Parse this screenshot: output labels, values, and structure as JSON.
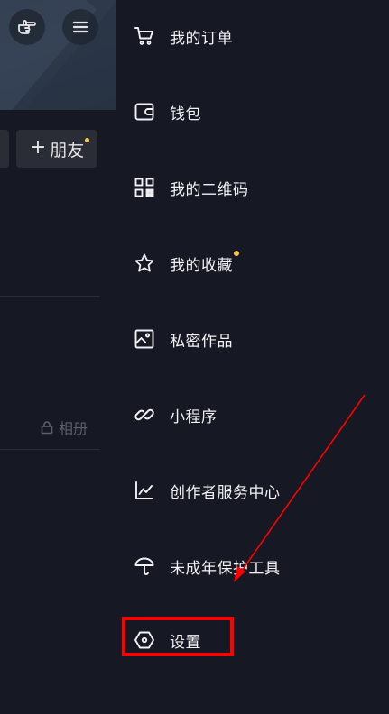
{
  "left_page": {
    "friends_button": {
      "plus": "+",
      "label": "朋友"
    },
    "album_tab": {
      "label": "相册",
      "icon": "lock-icon"
    },
    "header_icons": [
      "hand-pointer-icon",
      "hamburger-menu-icon"
    ]
  },
  "drawer": {
    "items": [
      {
        "label": "我的订单",
        "icon": "shopping-cart-icon",
        "badge": false
      },
      {
        "label": "钱包",
        "icon": "wallet-icon",
        "badge": false
      },
      {
        "label": "我的二维码",
        "icon": "qr-code-icon",
        "badge": false
      },
      {
        "label": "我的收藏",
        "icon": "star-icon",
        "badge": true
      },
      {
        "label": "私密作品",
        "icon": "image-icon",
        "badge": false
      },
      {
        "label": "小程序",
        "icon": "link-icon",
        "badge": false
      },
      {
        "label": "创作者服务中心",
        "icon": "line-chart-icon",
        "badge": false
      },
      {
        "label": "未成年保护工具",
        "icon": "umbrella-icon",
        "badge": false
      },
      {
        "label": "设置",
        "icon": "settings-hexagon-icon",
        "badge": false
      }
    ]
  },
  "colors": {
    "background": "#161823",
    "text": "#f2f2f4",
    "badge_dot": "#f7c946",
    "annotation_red": "#ff0000"
  }
}
